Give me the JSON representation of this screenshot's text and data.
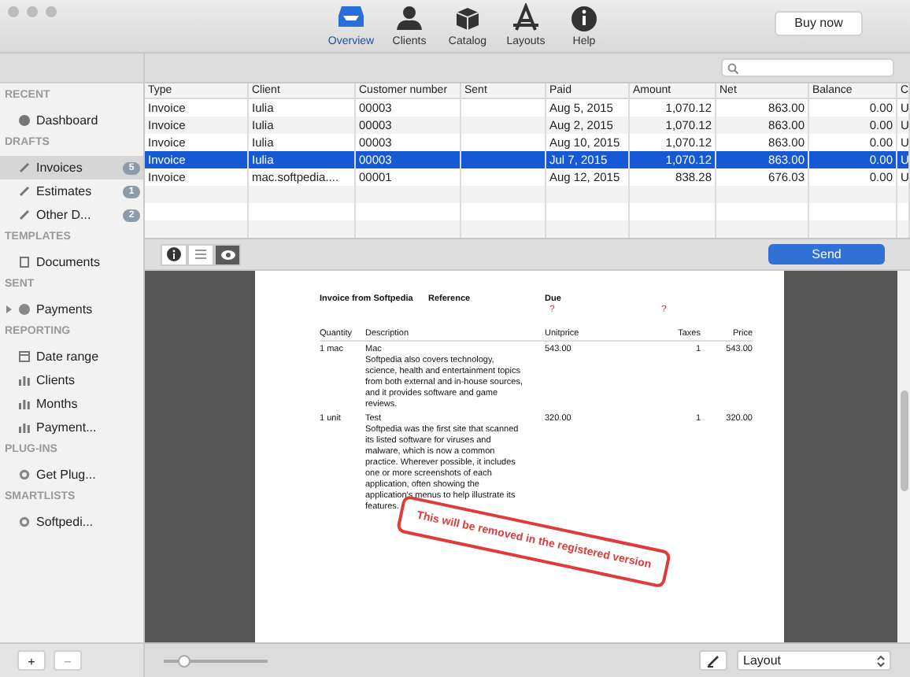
{
  "toolbar": {
    "items": [
      {
        "label": "Overview",
        "selected": true,
        "kind": "overview"
      },
      {
        "label": "Clients",
        "selected": false,
        "kind": "clients"
      },
      {
        "label": "Catalog",
        "selected": false,
        "kind": "catalog"
      },
      {
        "label": "Layouts",
        "selected": false,
        "kind": "layouts"
      },
      {
        "label": "Help",
        "selected": false,
        "kind": "help"
      }
    ],
    "buy_button": "Buy now"
  },
  "sidebar": {
    "sections": [
      {
        "heading": "RECENT",
        "items": [
          {
            "label": "Dashboard",
            "kind": "dashboard",
            "selected": false
          }
        ]
      },
      {
        "heading": "DRAFTS",
        "items": [
          {
            "label": "Invoices",
            "kind": "draft",
            "badge": "5",
            "selected": true
          },
          {
            "label": "Estimates",
            "kind": "draft",
            "badge": "1",
            "selected": false
          },
          {
            "label": "Other D...",
            "kind": "draft",
            "badge": "2",
            "selected": false
          }
        ]
      },
      {
        "heading": "TEMPLATES",
        "items": [
          {
            "label": "Documents",
            "kind": "document",
            "selected": false
          }
        ]
      },
      {
        "heading": "SENT",
        "items": [
          {
            "label": "Payments",
            "kind": "payment",
            "expanded": false,
            "selected": false
          }
        ]
      },
      {
        "heading": "REPORTING",
        "items": [
          {
            "label": "Date range",
            "kind": "calendar",
            "selected": false
          },
          {
            "label": "Clients",
            "kind": "chart",
            "selected": false
          },
          {
            "label": "Months",
            "kind": "chart",
            "selected": false
          },
          {
            "label": "Payment...",
            "kind": "chart",
            "selected": false
          }
        ]
      },
      {
        "heading": "PLUG-INS",
        "items": [
          {
            "label": "Get Plug...",
            "kind": "gear",
            "selected": false
          }
        ]
      },
      {
        "heading": "SMARTLISTS",
        "items": [
          {
            "label": "Softpedi...",
            "kind": "gear",
            "selected": false
          }
        ]
      }
    ],
    "add_button": "+",
    "remove_button": "−"
  },
  "table": {
    "columns": [
      "Type",
      "Client",
      "Customer number",
      "Sent",
      "Paid",
      "Amount",
      "Net",
      "Balance",
      "C"
    ],
    "rows": [
      {
        "cells": [
          "Invoice",
          "Iulia",
          "00003",
          "",
          "Aug 5, 2015",
          "1,070.12",
          "863.00",
          "0.00",
          "U"
        ],
        "selected": false
      },
      {
        "cells": [
          "Invoice",
          "Iulia",
          "00003",
          "",
          "Aug 2, 2015",
          "1,070.12",
          "863.00",
          "0.00",
          "U"
        ],
        "selected": false
      },
      {
        "cells": [
          "Invoice",
          "Iulia",
          "00003",
          "",
          "Aug 10, 2015",
          "1,070.12",
          "863.00",
          "0.00",
          "U"
        ],
        "selected": false
      },
      {
        "cells": [
          "Invoice",
          "Iulia",
          "00003",
          "",
          "Jul 7, 2015",
          "1,070.12",
          "863.00",
          "0.00",
          "U"
        ],
        "selected": true
      },
      {
        "cells": [
          "Invoice",
          "mac.softpedia....",
          "00001",
          "",
          "Aug 12, 2015",
          "838.28",
          "676.03",
          "0.00",
          "U"
        ],
        "selected": false
      }
    ]
  },
  "preview_toolbar": {
    "views": [
      {
        "kind": "info",
        "selected": false
      },
      {
        "kind": "list",
        "selected": false
      },
      {
        "kind": "preview",
        "selected": true
      }
    ],
    "send_button": "Send"
  },
  "document": {
    "title": "Invoice from Softpedia",
    "reference_label": "Reference",
    "due_label": "Due",
    "missing_marks": [
      "?",
      "?"
    ],
    "columns": [
      "Quantity",
      "Description",
      "Unitprice",
      "Taxes",
      "Price"
    ],
    "lines": [
      {
        "quantity": "1 mac",
        "name": "Mac",
        "description": "Softpedia also covers technology, science, health and entertainment topics from both external and in-house sources, and it provides software and game reviews.",
        "unitprice": "543.00",
        "taxes": "1",
        "price": "543.00"
      },
      {
        "quantity": "1 unit",
        "name": "Test",
        "description": "Softpedia was the first site that scanned its listed software for viruses and malware, which is now a common practice. Wherever possible, it includes one or more screenshots of each application, often showing the application's menus to help illustrate its features.",
        "unitprice": "320.00",
        "taxes": "1",
        "price": "320.00"
      }
    ],
    "stamp": "This will be removed in the registered version"
  },
  "bottom_bar": {
    "zoom": {
      "level": 0.2
    },
    "layout_select": "Layout"
  }
}
